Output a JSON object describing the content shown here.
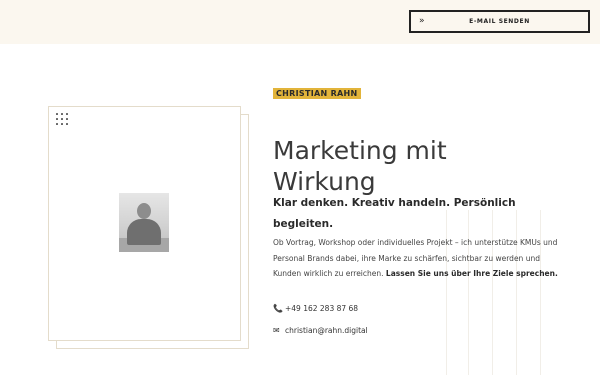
{
  "header": {
    "cta_arrow": "»",
    "cta_label": "E-MAIL SENDEN"
  },
  "hero": {
    "badge": "CHRISTIAN RAHN",
    "headline": "Marketing mit Wirkung",
    "subheadline": "Klar denken. Kreativ handeln. Persönlich begleiten.",
    "body": "Ob Vortrag, Workshop oder individuelles Projekt – ich unterstütze KMUs und Personal Brands dabei, ihre Marke zu schärfen, sichtbar zu werden und Kunden wirklich zu erreichen.",
    "body_emphasis": "Lassen Sie uns über Ihre Ziele sprechen.",
    "phone": "+49 162 283 87 68",
    "email": "christian@rahn.digital"
  },
  "icons": {
    "phone": "phone-icon",
    "email": "envelope-icon",
    "dots": "dot-grid-icon"
  },
  "colors": {
    "topbar": "#fbf7ef",
    "accent": "#e2b43a",
    "text": "#333333",
    "frame": "#e4dccb"
  }
}
